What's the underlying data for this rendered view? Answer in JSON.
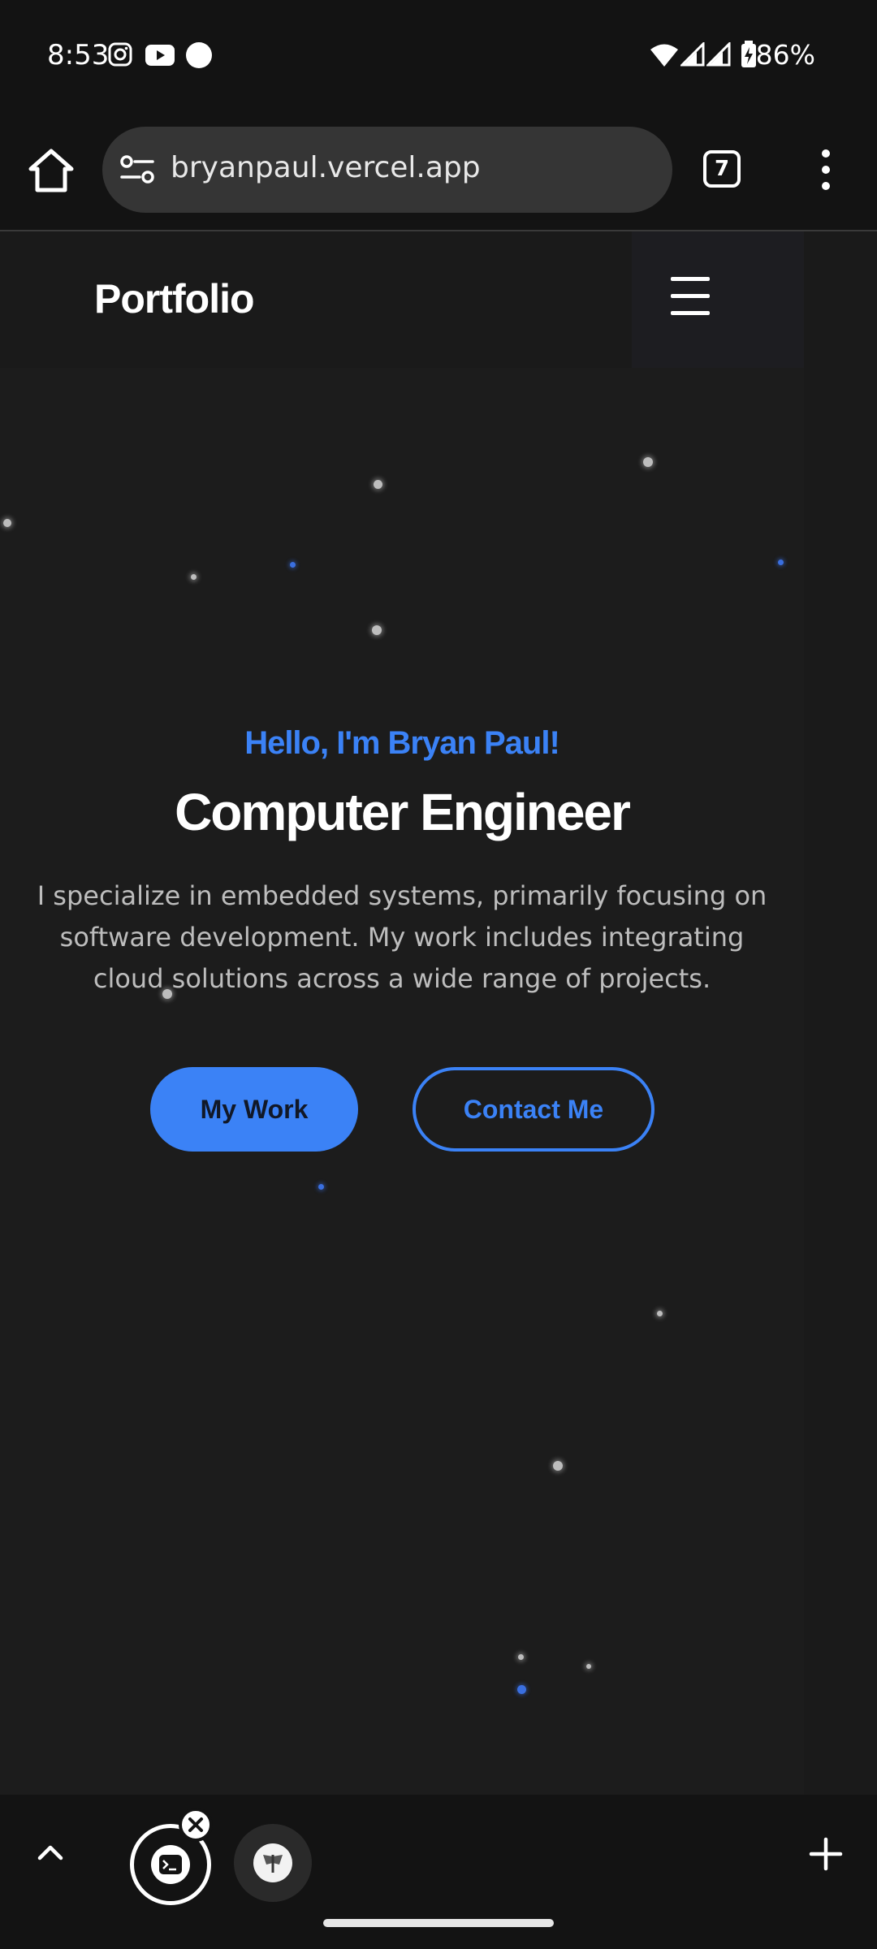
{
  "status_bar": {
    "time": "8:53",
    "battery": "86%",
    "left_icons": [
      "instagram-icon",
      "youtube-icon",
      "dot-icon"
    ],
    "right_icons": [
      "wifi-icon",
      "signal-icon",
      "signal-icon",
      "battery-charging-icon"
    ]
  },
  "browser": {
    "url": "bryanpaul.vercel.app",
    "tab_count": "7"
  },
  "site": {
    "brand": "Portfolio",
    "greeting": "Hello, I'm Bryan Paul!",
    "headline": "Computer Engineer",
    "description": "I specialize in embedded systems, primarily focusing on software development. My work includes integrating cloud solutions across a wide range of projects.",
    "primary_button": "My Work",
    "secondary_button": "Contact Me",
    "colors": {
      "accent": "#3b82f6",
      "background": "#1c1c1c",
      "text": "#ffffff",
      "muted_text": "#bdbdbd"
    }
  },
  "bottom_bar": {
    "icons": [
      "chevron-up-icon",
      "terminal-app-icon",
      "close-icon",
      "moth-app-icon",
      "plus-icon"
    ]
  }
}
